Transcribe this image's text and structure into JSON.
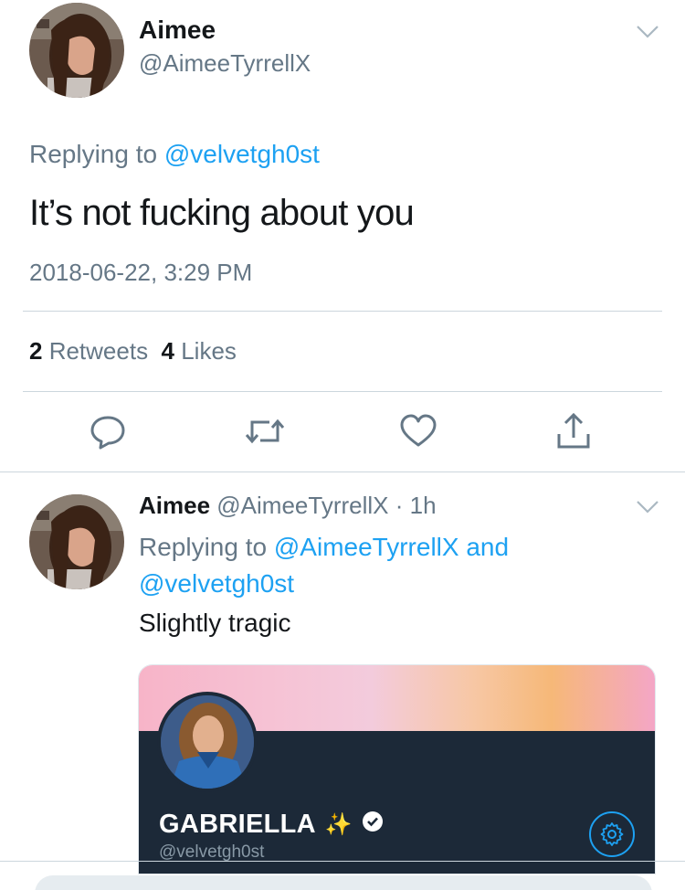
{
  "main_tweet": {
    "display_name": "Aimee",
    "handle": "@AimeeTyrrellX",
    "replying_prefix": "Replying to ",
    "replying_handle": "@velvetgh0st",
    "text": "It’s not fucking about you",
    "timestamp": "2018-06-22, 3:29 PM",
    "retweets_count": "2",
    "retweets_label": " Retweets",
    "likes_count": "4",
    "likes_label": " Likes"
  },
  "actions": {
    "reply_icon": "reply-icon",
    "retweet_icon": "retweet-icon",
    "like_icon": "heart-icon",
    "share_icon": "share-icon"
  },
  "reply_tweet": {
    "display_name": "Aimee",
    "handle": "@AimeeTyrrellX",
    "separator": " · ",
    "time": "1h",
    "replying_prefix": "Replying to ",
    "replying_handle_1": "@AimeeTyrrellX",
    "replying_and": " and",
    "replying_handle_2": "@velvetgh0st",
    "text": "Slightly tragic"
  },
  "embedded_card": {
    "name": "GABRIELLA",
    "sparkle": "✨",
    "handle": "@velvetgh0st"
  },
  "colors": {
    "link": "#1da1f2",
    "muted": "#657786",
    "card_bg": "#1c2938"
  }
}
